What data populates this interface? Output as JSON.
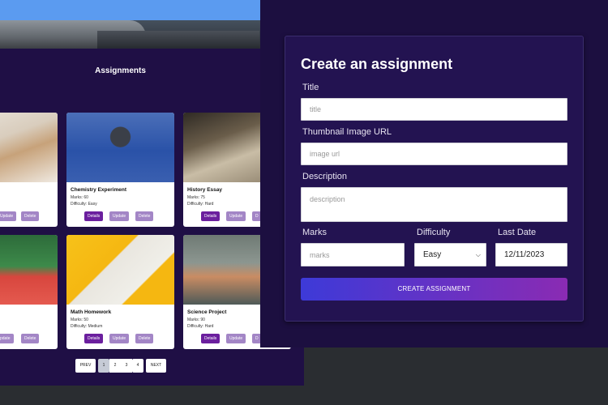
{
  "assignments": {
    "section_title": "Assignments",
    "cards": [
      {
        "title": "",
        "marks": "",
        "difficulty": "",
        "update_label": "Update",
        "delete_label": "Delete"
      },
      {
        "title": "Chemistry Experiment",
        "marks": "Marks: 60",
        "difficulty": "Difficulty: Easy",
        "details_label": "Details",
        "update_label": "Update",
        "delete_label": "Delete"
      },
      {
        "title": "History Essay",
        "marks": "Marks: 75",
        "difficulty": "Difficulty: Hard",
        "details_label": "Details",
        "update_label": "Update",
        "delete_label": "D"
      },
      {
        "title": "nment",
        "marks": "",
        "difficulty": "",
        "update_label": "pdate",
        "delete_label": "Delete"
      },
      {
        "title": "Math Homework",
        "marks": "Marks: 50",
        "difficulty": "Difficulty: Medium",
        "details_label": "Details",
        "update_label": "Update",
        "delete_label": "Delete"
      },
      {
        "title": "Science Project",
        "marks": "Marks: 90",
        "difficulty": "Difficulty: Hard",
        "details_label": "Details",
        "update_label": "Update",
        "delete_label": "D"
      }
    ],
    "pagination": {
      "prev": "PREV",
      "pages": [
        "1",
        "2",
        "3",
        "4"
      ],
      "next": "NEXT",
      "active": "1"
    }
  },
  "form": {
    "title": "Create an assignment",
    "title_label": "Title",
    "title_placeholder": "title",
    "thumb_label": "Thumbnail Image URL",
    "thumb_placeholder": "image url",
    "desc_label": "Description",
    "desc_placeholder": "description",
    "marks_label": "Marks",
    "marks_placeholder": "marks",
    "difficulty_label": "Difficulty",
    "difficulty_value": "Easy",
    "date_label": "Last Date",
    "date_value": "12/11/2023",
    "submit_label": "CREATE ASSIGNMENT"
  },
  "colors": {
    "page_bg": "#1f0f45",
    "form_bg": "#231351",
    "details_button": "#6b1f9e",
    "secondary_button": "#a386c6",
    "submit_gradient_start": "#3d3ad8",
    "submit_gradient_end": "#8a2bb3"
  }
}
